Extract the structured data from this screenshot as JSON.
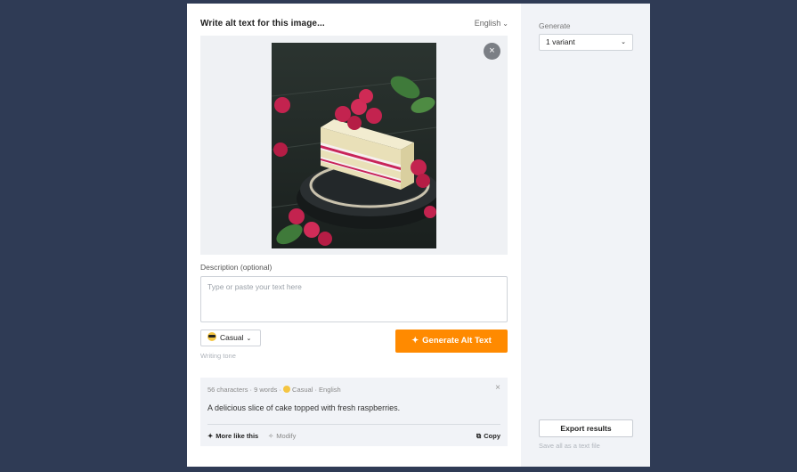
{
  "header": {
    "title": "Write alt text for this image...",
    "language": "English"
  },
  "image": {
    "remove_label": "×"
  },
  "description": {
    "label": "Description (optional)",
    "placeholder": "Type or paste your text here",
    "value": ""
  },
  "tone": {
    "selected": "Casual",
    "label": "Writing tone",
    "icon": "sunglasses-emoji-icon"
  },
  "generate_button": {
    "label": "Generate Alt Text",
    "icon": "sparkle-icon"
  },
  "result": {
    "meta": "56 characters · 9 words · ",
    "meta_tone": "Casual",
    "meta_lang": " · English",
    "text": "A delicious slice of cake topped with fresh raspberries.",
    "close_label": "×",
    "actions": {
      "more_like_this": "More like this",
      "modify": "Modify",
      "copy": "Copy"
    }
  },
  "sidebar": {
    "generate_label": "Generate",
    "variant_selected": "1 variant",
    "export_label": "Export results",
    "export_sub": "Save all as a text file"
  },
  "colors": {
    "accent": "#ff8a00",
    "background": "#2f3b55",
    "sidebar": "#f1f3f7"
  }
}
